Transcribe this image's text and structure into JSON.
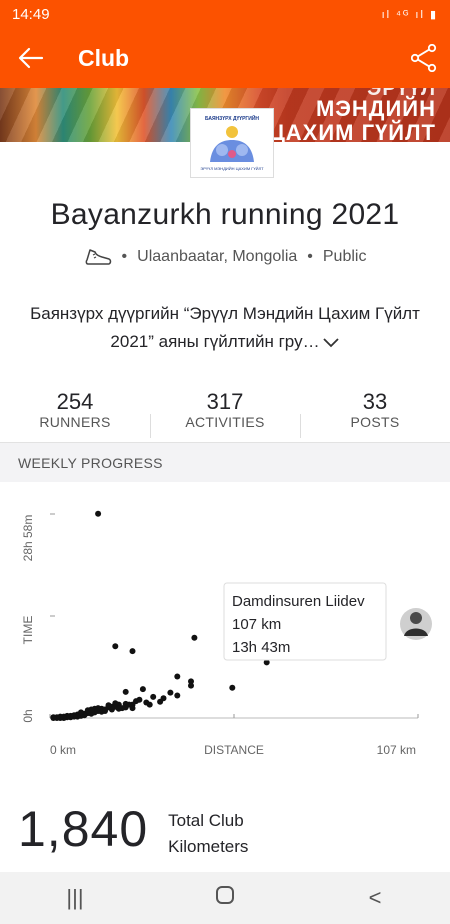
{
  "status_bar": {
    "time": "14:49",
    "indicators": "ıl ⁴ᴳ ıl ▮"
  },
  "app_bar": {
    "title": "Club",
    "back_icon": "arrow-left-icon",
    "share_icon": "share-icon"
  },
  "banner": {
    "line0": "ЭРҮҮЛ",
    "line1": "МЭНДИЙН",
    "line2": "ЦАХИМ ГҮЙЛТ"
  },
  "logo": {
    "top_text": "БАЯНЗҮРХ ДҮҮРГИЙН",
    "bottom_text": "ЭРҮҮЛ МЭНДИЙН ЦАХИМ ГҮЙЛТ"
  },
  "club": {
    "name": "Bayanzurkh running 2021",
    "sport_icon": "running-shoe-icon",
    "location": "Ulaanbaatar, Mongolia",
    "visibility": "Public",
    "description": "Баянзүрх дүүргийн “Эрүүл Мэндийн Цахим Гүйлт 2021” аяны гүйлтийн гру…"
  },
  "stats": [
    {
      "value": "254",
      "label": "RUNNERS"
    },
    {
      "value": "317",
      "label": "ACTIVITIES"
    },
    {
      "value": "33",
      "label": "POSTS"
    }
  ],
  "weekly_progress": {
    "header": "WEEKLY PROGRESS"
  },
  "tooltip": {
    "name": "Damdinsuren Liidev",
    "distance": "107 km",
    "time": "13h 43m"
  },
  "total": {
    "value": "1,840",
    "label_line1": "Total Club",
    "label_line2": "Kilometers"
  },
  "nav": {
    "recents": "|||",
    "home": "○",
    "back": "<"
  },
  "chart_data": {
    "type": "scatter",
    "xlabel": "DISTANCE",
    "ylabel": "TIME",
    "x_tick_labels": [
      "0 km",
      "107 km"
    ],
    "y_tick_labels": [
      "0h",
      "28h 58m"
    ],
    "xlim": [
      0,
      107
    ],
    "ylim": [
      0,
      28.97
    ],
    "x_unit": "km",
    "y_unit": "h",
    "points": [
      [
        14,
        29.0
      ],
      [
        19,
        10.2
      ],
      [
        24,
        9.5
      ],
      [
        42,
        11.4
      ],
      [
        63,
        7.9
      ],
      [
        91,
        14.9
      ],
      [
        107,
        13.7
      ],
      [
        53,
        4.3
      ],
      [
        37,
        5.9
      ],
      [
        41,
        5.2
      ],
      [
        41,
        4.6
      ],
      [
        27,
        4.1
      ],
      [
        37,
        3.2
      ],
      [
        35,
        3.6
      ],
      [
        30,
        3.0
      ],
      [
        33,
        2.8
      ],
      [
        32,
        2.3
      ],
      [
        28,
        2.2
      ],
      [
        29,
        1.9
      ],
      [
        22,
        3.7
      ],
      [
        25,
        2.4
      ],
      [
        24,
        1.9
      ],
      [
        24,
        1.4
      ],
      [
        22,
        1.5
      ],
      [
        23,
        1.9
      ],
      [
        20,
        1.9
      ],
      [
        21,
        1.4
      ],
      [
        19,
        1.6
      ],
      [
        18,
        1.2
      ],
      [
        17,
        1.5
      ],
      [
        16,
        1.2
      ],
      [
        15,
        1.3
      ],
      [
        15,
        0.9
      ],
      [
        14,
        1.0
      ],
      [
        13,
        0.8
      ],
      [
        12,
        0.9
      ],
      [
        12,
        0.6
      ],
      [
        11,
        0.7
      ],
      [
        10,
        0.6
      ],
      [
        10,
        0.4
      ],
      [
        9,
        0.6
      ],
      [
        9,
        0.3
      ],
      [
        8,
        0.5
      ],
      [
        8,
        0.2
      ],
      [
        7,
        0.4
      ],
      [
        7,
        0.2
      ],
      [
        6,
        0.3
      ],
      [
        6,
        0.1
      ],
      [
        5,
        0.3
      ],
      [
        5,
        0.1
      ],
      [
        4,
        0.2
      ],
      [
        4,
        0.0
      ],
      [
        3,
        0.2
      ],
      [
        3,
        0.0
      ],
      [
        2,
        0.1
      ],
      [
        2,
        0.0
      ],
      [
        1,
        0.1
      ],
      [
        1,
        0.0
      ],
      [
        11,
        1.1
      ],
      [
        13,
        1.3
      ],
      [
        16,
        1.0
      ],
      [
        18,
        1.6
      ],
      [
        20,
        1.3
      ],
      [
        22,
        2.0
      ],
      [
        26,
        2.6
      ],
      [
        9,
        0.8
      ],
      [
        14,
        1.4
      ],
      [
        17,
        1.8
      ],
      [
        12,
        1.2
      ],
      [
        19,
        2.1
      ]
    ],
    "highlight": {
      "x": 107,
      "y": 13.72
    }
  }
}
